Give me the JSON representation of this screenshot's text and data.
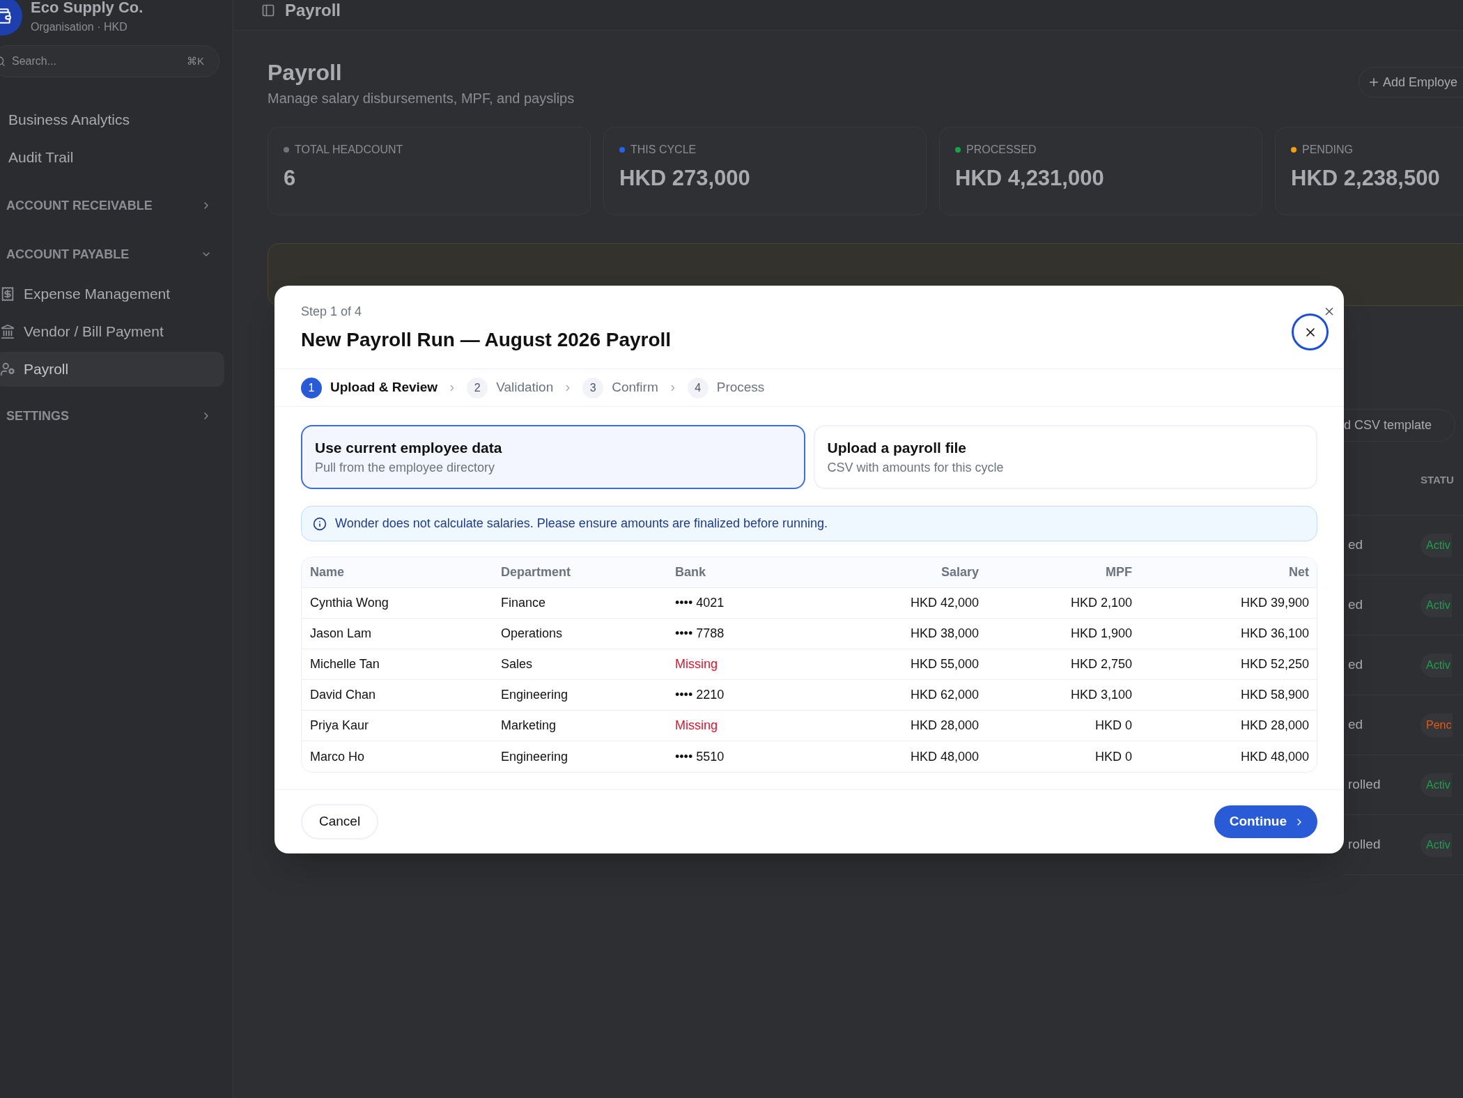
{
  "sidebar": {
    "org": {
      "name": "Eco Supply Co.",
      "subtitle": "Organisation · HKD"
    },
    "search": {
      "placeholder": "Search...",
      "shortcut": "⌘K"
    },
    "items": [
      {
        "kind": "link",
        "label": "Business Analytics"
      },
      {
        "kind": "link",
        "label": "Audit Trail"
      },
      {
        "kind": "section",
        "label": "ACCOUNT RECEIVABLE",
        "expanded": false
      },
      {
        "kind": "section",
        "label": "ACCOUNT PAYABLE",
        "expanded": true,
        "children": [
          {
            "label": "Expense Management",
            "selected": false
          },
          {
            "label": "Vendor / Bill Payment",
            "selected": false
          },
          {
            "label": "Payroll",
            "selected": true
          }
        ]
      },
      {
        "kind": "section",
        "label": "SETTINGS",
        "expanded": false
      }
    ]
  },
  "header": {
    "title": "Payroll"
  },
  "page": {
    "title": "Payroll",
    "subtitle": "Manage salary disbursements, MPF, and payslips",
    "add_button": "Add Employe"
  },
  "stats": [
    {
      "label": "TOTAL HEADCOUNT",
      "value": "6",
      "color": "#6b7280"
    },
    {
      "label": "THIS CYCLE",
      "value": "HKD 273,000",
      "color": "#2563eb"
    },
    {
      "label": "PROCESSED",
      "value": "HKD 4,231,000",
      "color": "#16a34a"
    },
    {
      "label": "PENDING",
      "value": "HKD 2,238,500",
      "color": "#f59e0b"
    }
  ],
  "background_table": {
    "template_button": "d CSV template",
    "status_header": "STATU",
    "rows": [
      {
        "cell": "ed",
        "status": "Activ",
        "color": "#16a34a"
      },
      {
        "cell": "ed",
        "status": "Activ",
        "color": "#16a34a"
      },
      {
        "cell": "ed",
        "status": "Activ",
        "color": "#16a34a"
      },
      {
        "cell": "ed",
        "status": "Penc",
        "color": "#ea580c"
      },
      {
        "cell": "rolled",
        "status": "Activ",
        "color": "#16a34a"
      },
      {
        "cell": "rolled",
        "status": "Activ",
        "color": "#16a34a"
      }
    ]
  },
  "modal": {
    "step_label": "Step 1 of 4",
    "title": "New Payroll Run — August 2026 Payroll",
    "steps": [
      {
        "number": "1",
        "label": "Upload & Review",
        "selected": true
      },
      {
        "number": "2",
        "label": "Validation",
        "selected": false
      },
      {
        "number": "3",
        "label": "Confirm",
        "selected": false
      },
      {
        "number": "4",
        "label": "Process",
        "selected": false
      }
    ],
    "options": [
      {
        "title": "Use current employee data",
        "subtitle": "Pull from the employee directory",
        "selected": true
      },
      {
        "title": "Upload a payroll file",
        "subtitle": "CSV with amounts for this cycle",
        "selected": false
      }
    ],
    "notice": "Wonder does not calculate salaries. Please ensure amounts are finalized before running.",
    "table": {
      "columns": [
        "Name",
        "Department",
        "Bank",
        "Salary",
        "MPF",
        "Net"
      ],
      "rows": [
        {
          "name": "Cynthia Wong",
          "department": "Finance",
          "bank": "•••• 4021",
          "bank_missing": false,
          "salary": "HKD 42,000",
          "mpf": "HKD 2,100",
          "net": "HKD 39,900"
        },
        {
          "name": "Jason Lam",
          "department": "Operations",
          "bank": "•••• 7788",
          "bank_missing": false,
          "salary": "HKD 38,000",
          "mpf": "HKD 1,900",
          "net": "HKD 36,100"
        },
        {
          "name": "Michelle Tan",
          "department": "Sales",
          "bank": "Missing",
          "bank_missing": true,
          "salary": "HKD 55,000",
          "mpf": "HKD 2,750",
          "net": "HKD 52,250"
        },
        {
          "name": "David Chan",
          "department": "Engineering",
          "bank": "•••• 2210",
          "bank_missing": false,
          "salary": "HKD 62,000",
          "mpf": "HKD 3,100",
          "net": "HKD 58,900"
        },
        {
          "name": "Priya Kaur",
          "department": "Marketing",
          "bank": "Missing",
          "bank_missing": true,
          "salary": "HKD 28,000",
          "mpf": "HKD 0",
          "net": "HKD 28,000"
        },
        {
          "name": "Marco Ho",
          "department": "Engineering",
          "bank": "•••• 5510",
          "bank_missing": false,
          "salary": "HKD 48,000",
          "mpf": "HKD 0",
          "net": "HKD 48,000"
        }
      ]
    },
    "cancel": "Cancel",
    "continue": "Continue"
  }
}
